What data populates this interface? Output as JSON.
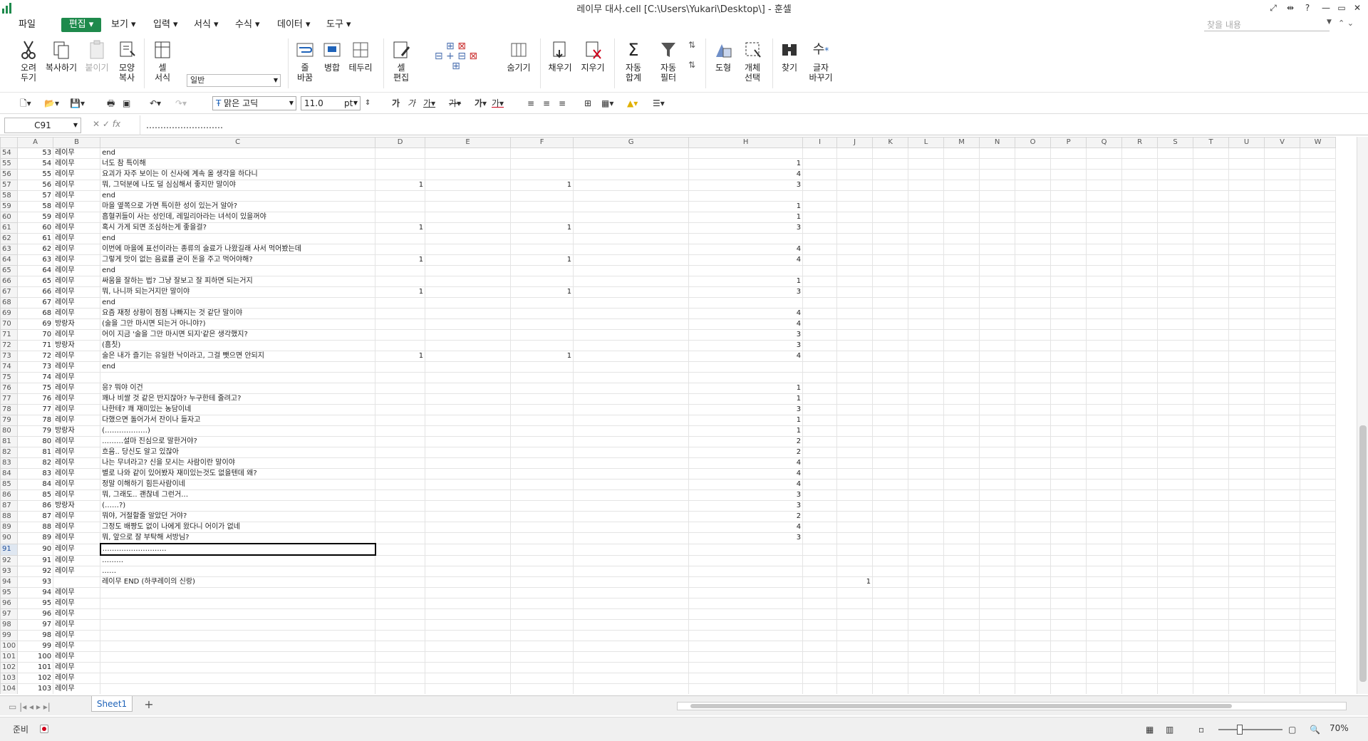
{
  "window": {
    "title": "레이무 대사.cell [C:\\Users\\Yukari\\Desktop\\] - 훈셀",
    "controls": [
      "⤢",
      "⇹",
      "?",
      "—",
      "▭",
      "✕"
    ]
  },
  "menu": {
    "items": [
      "파일",
      "편집",
      "보기",
      "입력",
      "서식",
      "수식",
      "데이터",
      "도구"
    ],
    "search_placeholder": "찾을 내용"
  },
  "ribbon": {
    "cut": "오려\n두기",
    "copy": "복사하기",
    "paste": "붙이기",
    "format_paint": "모양\n복사",
    "cell_format": "셀\n서식",
    "format_box": "일반",
    "percent": "%",
    "comma": ",",
    "wrap": "줄\n바꿈",
    "merge": "병합",
    "border": "테두리",
    "cell_edit": "셀\n편집",
    "hide": "숨기기",
    "fill": "채우기",
    "clear": "지우기",
    "autosum": "자동\n합계",
    "autofilter": "자동\n필터",
    "shape": "도형",
    "select_obj": "개체\n선택",
    "find": "찾기",
    "replace": "글자\n바꾸기"
  },
  "toolbar": {
    "font_name": "맑은 고딕",
    "font_size": "11.0",
    "font_unit": "pt"
  },
  "formula": {
    "cell": "C91",
    "content": "………………………"
  },
  "columns": [
    "A",
    "B",
    "C",
    "D",
    "E",
    "F",
    "G",
    "H",
    "I",
    "J",
    "K",
    "L",
    "M",
    "N",
    "O",
    "P",
    "Q",
    "R",
    "S",
    "T",
    "U",
    "V",
    "W"
  ],
  "rows": [
    {
      "r": "54",
      "a": "53",
      "b": "레이무",
      "c": "end"
    },
    {
      "r": "55",
      "a": "54",
      "b": "레이무",
      "c": "너도 참 특이해",
      "h": "1"
    },
    {
      "r": "56",
      "a": "55",
      "b": "레이무",
      "c": "요괴가 자주 보이는 이 신사에 계속 올 생각을 하다니",
      "h": "4"
    },
    {
      "r": "57",
      "a": "56",
      "b": "레이무",
      "c": "뭐, 그덕분에 나도 덜 심심해서 좋지만 말이야",
      "d": "1",
      "f": "1",
      "h": "3"
    },
    {
      "r": "58",
      "a": "57",
      "b": "레이무",
      "c": "end"
    },
    {
      "r": "59",
      "a": "58",
      "b": "레이무",
      "c": "마을 옆쪽으로 가면 특이한 성이 있는거 알아?",
      "h": "1"
    },
    {
      "r": "60",
      "a": "59",
      "b": "레이무",
      "c": "흡혈귀들이 사는 성인데, 레밀리아라는 녀석이 있을꺼야",
      "h": "1"
    },
    {
      "r": "61",
      "a": "60",
      "b": "레이무",
      "c": "혹시 가게 되면 조심하는게 좋을걸?",
      "d": "1",
      "f": "1",
      "h": "3"
    },
    {
      "r": "62",
      "a": "61",
      "b": "레이무",
      "c": "end"
    },
    {
      "r": "63",
      "a": "62",
      "b": "레이무",
      "c": "이번에 마을에 표선이라는 종류의 술료가 나왔길래 사서 먹어봤는데",
      "h": "4"
    },
    {
      "r": "64",
      "a": "63",
      "b": "레이무",
      "c": "그렇게 맛이 없는 음료를 굳이 돈을 주고 먹어야해?",
      "d": "1",
      "f": "1",
      "h": "4"
    },
    {
      "r": "65",
      "a": "64",
      "b": "레이무",
      "c": "end"
    },
    {
      "r": "66",
      "a": "65",
      "b": "레이무",
      "c": "싸움을 잘하는 법? 그냥 잘보고 잘 피하면 되는거지",
      "h": "1"
    },
    {
      "r": "67",
      "a": "66",
      "b": "레이무",
      "c": "뭐, 나니까 되는거지만 말이야",
      "d": "1",
      "f": "1",
      "h": "3"
    },
    {
      "r": "68",
      "a": "67",
      "b": "레이무",
      "c": "end"
    },
    {
      "r": "69",
      "a": "68",
      "b": "레이무",
      "c": "요즘 재정 상황이 점점 나빠지는 것 같단 말이야",
      "h": "4"
    },
    {
      "r": "70",
      "a": "69",
      "b": "방랑자",
      "c": "(술을 그만 마시면 되는거 아니야?)",
      "h": "4"
    },
    {
      "r": "71",
      "a": "70",
      "b": "레이무",
      "c": "어이 지금 '술을 그만 마시면 되지'같은 생각했지?",
      "h": "3"
    },
    {
      "r": "72",
      "a": "71",
      "b": "방랑자",
      "c": "(흠칫)",
      "h": "3"
    },
    {
      "r": "73",
      "a": "72",
      "b": "레이무",
      "c": "술은 내가 즐기는 유일한 낙이라고, 그걸 뺏으면 안되지",
      "d": "1",
      "f": "1",
      "h": "4"
    },
    {
      "r": "74",
      "a": "73",
      "b": "레이무",
      "c": "end"
    },
    {
      "r": "75",
      "a": "74",
      "b": "레이무",
      "c": ""
    },
    {
      "r": "76",
      "a": "75",
      "b": "레이무",
      "c": "응? 뭐야 이건",
      "h": "1"
    },
    {
      "r": "77",
      "a": "76",
      "b": "레이무",
      "c": "꽤나 비쌀 것 같은 반지잖아? 누구한테 줄려고?",
      "h": "1"
    },
    {
      "r": "78",
      "a": "77",
      "b": "레이무",
      "c": "나한테? 꽤 재미있는 농담이네",
      "h": "3"
    },
    {
      "r": "79",
      "a": "78",
      "b": "레이무",
      "c": "다했으면 돌어가서 잔이나 들자고",
      "h": "1"
    },
    {
      "r": "80",
      "a": "79",
      "b": "방랑자",
      "c": "(………………)",
      "h": "1"
    },
    {
      "r": "81",
      "a": "80",
      "b": "레이무",
      "c": "………설마 진심으로 말한거야?",
      "h": "2"
    },
    {
      "r": "82",
      "a": "81",
      "b": "레이무",
      "c": "흐음.. 당신도 알고 있잖아",
      "h": "2"
    },
    {
      "r": "83",
      "a": "82",
      "b": "레이무",
      "c": "나는 무녀라고? 신을 모시는 사람이란 말이야",
      "h": "4"
    },
    {
      "r": "84",
      "a": "83",
      "b": "레이무",
      "c": "별로 나와 같이 있어봤자 재미있는것도 없을텐데 왜?",
      "h": "4"
    },
    {
      "r": "85",
      "a": "84",
      "b": "레이무",
      "c": "정말 이해하기 힘든사람이네",
      "h": "4"
    },
    {
      "r": "86",
      "a": "85",
      "b": "레이무",
      "c": "뭐, 그래도.. 괜찮네 그런거…",
      "h": "3"
    },
    {
      "r": "87",
      "a": "86",
      "b": "방랑자",
      "c": "(……?)",
      "h": "3"
    },
    {
      "r": "88",
      "a": "87",
      "b": "레이무",
      "c": "뭐야, 거절할줄 알았던 거야?",
      "h": "2"
    },
    {
      "r": "89",
      "a": "88",
      "b": "레이무",
      "c": "그정도 배짱도 없이 나에게 왔다니 어이가 없네",
      "h": "4"
    },
    {
      "r": "90",
      "a": "89",
      "b": "레이무",
      "c": "뭐, 앞으로 잘 부탁해 서방님?",
      "h": "3"
    },
    {
      "r": "91",
      "a": "90",
      "b": "레이무",
      "c": "………………………",
      "selected": true
    },
    {
      "r": "92",
      "a": "91",
      "b": "레이무",
      "c": "………"
    },
    {
      "r": "93",
      "a": "92",
      "b": "레이무",
      "c": "……"
    },
    {
      "r": "94",
      "a": "93",
      "b": "",
      "c": "레이무 END (하쿠레이의 신랑)",
      "j": "1"
    },
    {
      "r": "95",
      "a": "94",
      "b": "레이무",
      "c": ""
    },
    {
      "r": "96",
      "a": "95",
      "b": "레이무",
      "c": ""
    },
    {
      "r": "97",
      "a": "96",
      "b": "레이무",
      "c": ""
    },
    {
      "r": "98",
      "a": "97",
      "b": "레이무",
      "c": ""
    },
    {
      "r": "99",
      "a": "98",
      "b": "레이무",
      "c": ""
    },
    {
      "r": "100",
      "a": "99",
      "b": "레이무",
      "c": ""
    },
    {
      "r": "101",
      "a": "100",
      "b": "레이무",
      "c": ""
    },
    {
      "r": "102",
      "a": "101",
      "b": "레이무",
      "c": ""
    },
    {
      "r": "103",
      "a": "102",
      "b": "레이무",
      "c": ""
    },
    {
      "r": "104",
      "a": "103",
      "b": "레이무",
      "c": ""
    }
  ],
  "sheet": {
    "tab": "Sheet1"
  },
  "status": {
    "text": "준비",
    "zoom": "70%"
  },
  "colors": {
    "accent": "#1e8a4c",
    "selection_header": "#dfe7f1",
    "link_blue": "#1f63b9"
  }
}
